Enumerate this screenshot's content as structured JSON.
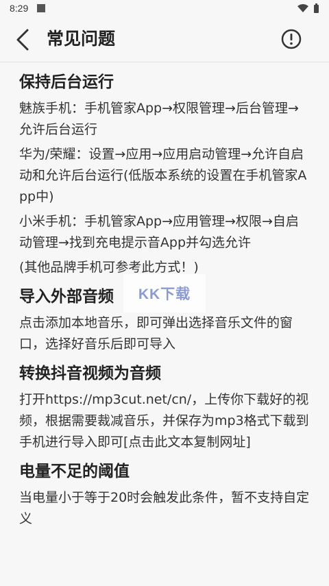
{
  "status_bar": {
    "time": "8:29",
    "icons": [
      "notification-square-icon",
      "wifi-icon",
      "battery-icon"
    ]
  },
  "app_bar": {
    "title": "常见问题",
    "back_icon": "chevron-left-icon",
    "info_icon": "info-circle-icon"
  },
  "faq": [
    {
      "question": "保持后台运行",
      "answers": [
        "魅族手机：手机管家App→权限管理→后台管理→允许后台运行",
        "华为/荣耀：设置→应用→应用启动管理→允许自启动和允许后台运行(低版本系统的设置在手机管家App中)",
        "小米手机：手机管家App→应用管理→权限→自启动管理→找到充电提示音App并勾选允许",
        "(其他品牌手机可参考此方式！)"
      ]
    },
    {
      "question": "导入外部音频",
      "answers": [
        "点击添加本地音乐，即可弹出选择音乐文件的窗口，选择好音乐后即可导入"
      ]
    },
    {
      "question": "转换抖音视频为音频",
      "answers": [
        "打开https://mp3cut.net/cn/，上传你下载好的视频，根据需要裁减音乐，并保存为mp3格式下载到手机进行导入即可[点击此文本复制网址]"
      ]
    },
    {
      "question": "电量不足的阈值",
      "answers": [
        "当电量小于等于20时会触发此条件，暂不支持自定义"
      ]
    }
  ],
  "watermark": "KK下载",
  "colors": {
    "background": "#f7f7f7",
    "text": "#222222",
    "watermark": "#8a9bd1"
  }
}
